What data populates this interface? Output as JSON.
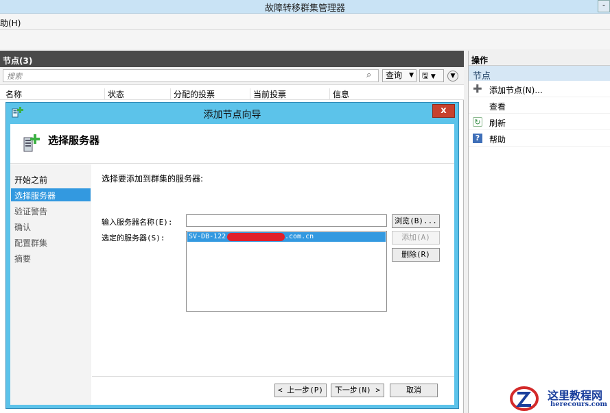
{
  "window": {
    "title": "故障转移群集管理器",
    "win_button": "-"
  },
  "menu": {
    "help_partial": "助(H)"
  },
  "left_pane": {
    "header": "节点(3)",
    "search_placeholder": "搜索",
    "query_label": "查询",
    "columns": [
      "名称",
      "状态",
      "分配的投票",
      "当前投票",
      "信息"
    ]
  },
  "right_pane": {
    "header": "操作",
    "section": "节点",
    "items": [
      {
        "label": "添加节点(N)...",
        "icon": "add-node-icon"
      },
      {
        "label": "查看",
        "icon": ""
      },
      {
        "label": "刷新",
        "icon": "refresh-icon"
      },
      {
        "label": "帮助",
        "icon": "help-icon"
      }
    ]
  },
  "dialog": {
    "title": "添加节点向导",
    "close": "x",
    "heading": "选择服务器",
    "steps": [
      "开始之前",
      "选择服务器",
      "验证警告",
      "确认",
      "配置群集",
      "摘要"
    ],
    "active_step": 1,
    "prompt": "选择要添加到群集的服务器:",
    "name_label": "输入服务器名称(E):",
    "selected_label": "选定的服务器(S):",
    "name_value": "",
    "selected_servers": [
      {
        "prefix": "SV-DB-122-",
        "suffix": ".com.cn"
      }
    ],
    "buttons": {
      "browse": "浏览(B)...",
      "add": "添加(A)",
      "remove": "删除(R)",
      "back": "< 上一步(P)",
      "next": "下一步(N) >",
      "cancel": "取消"
    }
  },
  "watermark": {
    "text": "这里教程网",
    "url": "herecours.com"
  },
  "colors": {
    "dialog_frame": "#5cc3ea",
    "selection": "#3399e0",
    "close": "#c7412d"
  }
}
